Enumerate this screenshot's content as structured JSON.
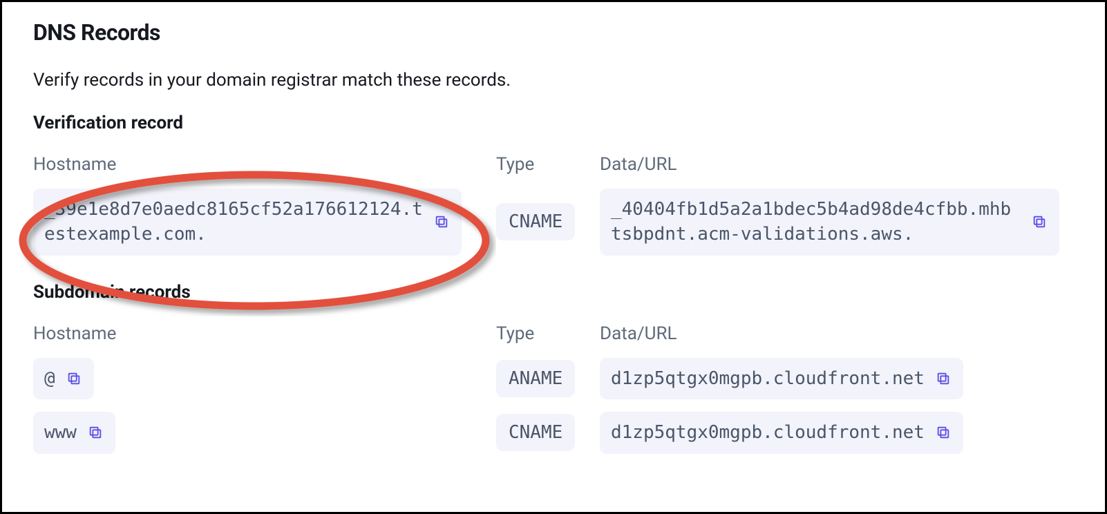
{
  "page": {
    "title": "DNS Records",
    "description": "Verify records in your domain registrar match these records."
  },
  "sections": {
    "verification": {
      "title": "Verification record",
      "headers": {
        "hostname": "Hostname",
        "type": "Type",
        "data": "Data/URL"
      },
      "record": {
        "hostname": "_39e1e8d7e0aedc8165cf52a176612124.testexample.com.",
        "type": "CNAME",
        "data": "_40404fb1d5a2a1bdec5b4ad98de4cfbb.mhbtsbpdnt.acm-validations.aws."
      }
    },
    "subdomain": {
      "title": "Subdomain records",
      "headers": {
        "hostname": "Hostname",
        "type": "Type",
        "data": "Data/URL"
      },
      "records": [
        {
          "hostname": "@",
          "type": "ANAME",
          "data": "d1zp5qtgx0mgpb.cloudfront.net"
        },
        {
          "hostname": "www",
          "type": "CNAME",
          "data": "d1zp5qtgx0mgpb.cloudfront.net"
        }
      ]
    }
  }
}
